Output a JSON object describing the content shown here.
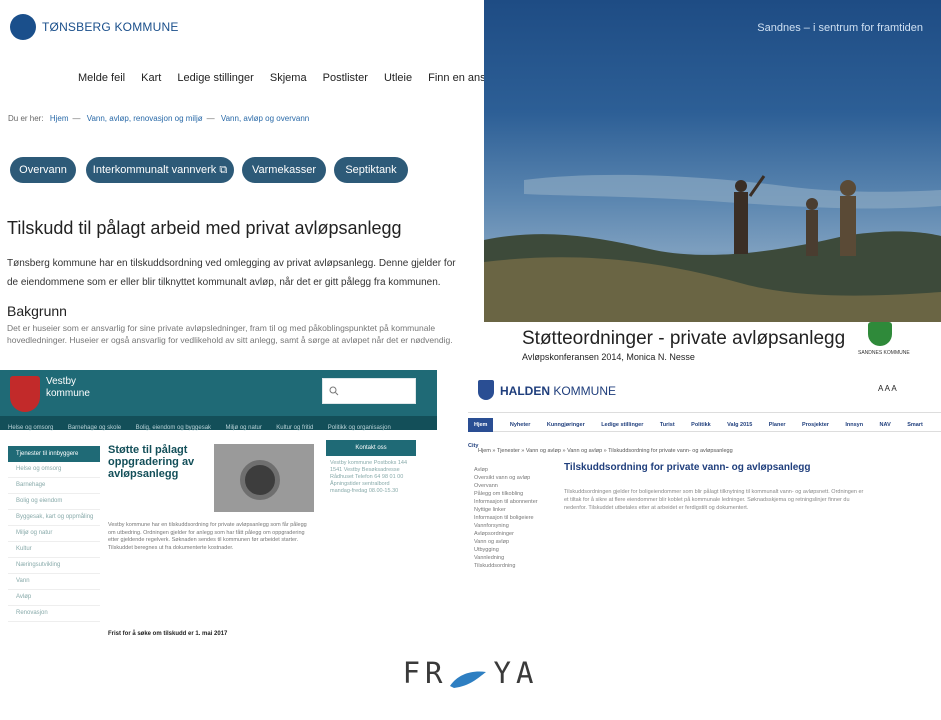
{
  "tonsberg": {
    "site_name": "TØNSBERG KOMMUNE",
    "nav": [
      "Melde feil",
      "Kart",
      "Ledige stillinger",
      "Skjema",
      "Postlister",
      "Utleie",
      "Finn en ansatt"
    ],
    "breadcrumb": {
      "prefix": "Du er her:",
      "items": [
        "Hjem",
        "Vann, avløp, renovasjon og miljø",
        "Vann, avløp og overvann"
      ]
    },
    "pills": [
      "Overvann",
      "Interkommunalt vannverk ⧉",
      "Varmekasser",
      "Septiktank"
    ],
    "title": "Tilskudd til pålagt arbeid med privat avløpsanlegg",
    "intro": "Tønsberg kommune har en tilskuddsordning ved omlegging av privat avløpsanlegg. Denne gjelder for de eiendommene som er eller blir tilknyttet kommunalt avløp, når det er gitt pålegg fra kommunen.",
    "section_heading": "Bakgrunn",
    "section_text": "Det er huseier som er ansvarlig for sine private avløpsledninger, fram til og med påkoblingspunktet på kommunale hovedledninger. Huseier er også ansvarlig for vedlikehold av sitt anlegg, samt å sørge at avløpet når det er nødvendig."
  },
  "sandnes": {
    "banner_text": "Sandnes – i sentrum for framtiden",
    "title": "Støtteordninger - private avløpsanlegg",
    "subtitle": "Avløpskonferansen 2014, Monica N. Nesse",
    "logo_text": "SANDNES KOMMUNE"
  },
  "vestby": {
    "site_name_line1": "Vestby",
    "site_name_line2": "kommune",
    "search_placeholder": "",
    "nav": [
      "Helse og omsorg",
      "Barnehage og skole",
      "Bolig, eiendom og byggesak",
      "Miljø og natur",
      "Kultur og fritid",
      "Politikk og organisasjon"
    ],
    "side_header": "Tjenester til innbyggere",
    "side_items": [
      "Helse og omsorg",
      "Barnehage",
      "Bolig og eiendom",
      "Byggesak, kart og oppmåling",
      "Miljø og natur",
      "Kultur",
      "Næringsutvikling",
      "Vann",
      "Avløp",
      "Renovasjon"
    ],
    "heading": "Støtte til pålagt oppgradering av avløpsanlegg",
    "body": "Vestby kommune har en tilskuddsordning for private avløpsanlegg som får pålegg om utbedring. Ordningen gjelder for anlegg som har fått pålegg om oppgradering etter gjeldende regelverk. Søknaden sendes til kommunen før arbeidet starter. Tilskuddet beregnes ut fra dokumenterte kostnader.",
    "bold_line": "Frist for å søke om tilskudd er 1. mai 2017",
    "contact_header": "Kontakt oss",
    "contact_text": "Vestby kommune Postboks 144 1541 Vestby Besøksadresse Rådhuset Telefon 64 98 01 00 Åpningstider sentralbord mandag-fredag 08.00-15.30"
  },
  "halden": {
    "site_name_bold": "HALDEN",
    "site_name_rest": " KOMMUNE",
    "aaa": "A A A",
    "nav": [
      "Hjem",
      "Nyheter",
      "Kunngjøringer",
      "Ledige stillinger",
      "Turist",
      "Politikk",
      "Valg 2015",
      "Planer",
      "Prosjekter",
      "Innsyn",
      "NAV",
      "Smart City"
    ],
    "breadcrumb": "Hjem » Tjenester » Vann og avløp » Vann og avløp » Tilskuddsordning for private vann- og avløpsanlegg",
    "left_menu": [
      "Avløp",
      "Oversikt vann og avløp",
      "Overvann",
      "Pålegg om tilkobling",
      "Informasjon til abonnenter",
      "Nyttige linker",
      "Informasjon til boligeiere",
      "Vannforsyning",
      "Avløpsordninger",
      "Vann og avløp",
      "Utbygging",
      "Vannledning",
      "Tilskuddsordning"
    ],
    "title": "Tilskuddsordning for private vann- og avløpsanlegg",
    "body": "Tilskuddsordningen gjelder for boligeiendommer som blir pålagt tilknytning til kommunalt vann- og avløpsnett. Ordningen er et tiltak for å sikre at flere eiendommer blir koblet på kommunale ledninger. Søknadsskjema og retningslinjer finner du nedenfor. Tilskuddet utbetales etter at arbeidet er ferdigstilt og dokumentert."
  },
  "froya": {
    "left": "FR",
    "right": "YA"
  }
}
